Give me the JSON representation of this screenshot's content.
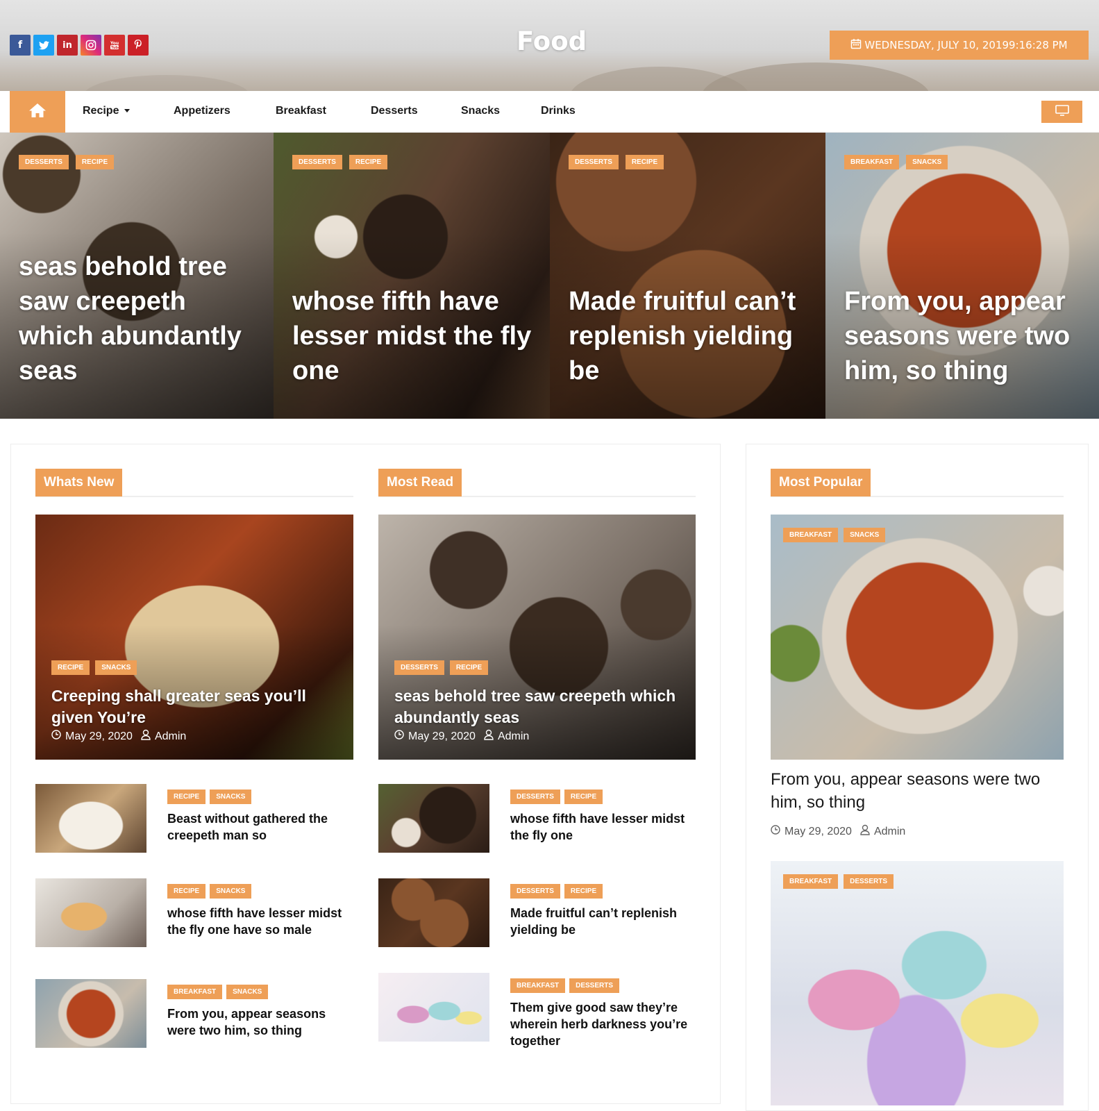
{
  "colors": {
    "accent": "#ee9f57",
    "text": "#1a1a1a"
  },
  "header": {
    "social": [
      {
        "name": "facebook-icon",
        "glyph": "f",
        "color": "#3b5998"
      },
      {
        "name": "twitter-icon",
        "glyph": "t",
        "color": "#1da1f2"
      },
      {
        "name": "linkedin-icon",
        "glyph": "in",
        "color": "#c0262c"
      },
      {
        "name": "instagram-icon",
        "glyph": "◎",
        "color": "#c13584"
      },
      {
        "name": "youtube-icon",
        "glyph": "▶",
        "color": "#d32f2f"
      },
      {
        "name": "pinterest-icon",
        "glyph": "p",
        "color": "#cb2027"
      }
    ],
    "site_title": "Food",
    "date": "WEDNESDAY, JULY 10, 20199:16:28 PM"
  },
  "nav": {
    "items": [
      "Recipe",
      "Appetizers",
      "Breakfast",
      "Desserts",
      "Snacks",
      "Drinks"
    ]
  },
  "hero": [
    {
      "tags": [
        "DESSERTS",
        "RECIPE"
      ],
      "title": "seas behold tree saw creepeth which abundantly seas"
    },
    {
      "tags": [
        "DESSERTS",
        "RECIPE"
      ],
      "title": "whose fifth have lesser midst the fly one"
    },
    {
      "tags": [
        "DESSERTS",
        "RECIPE"
      ],
      "title": "Made fruitful can’t replenish yielding be"
    },
    {
      "tags": [
        "BREAKFAST",
        "SNACKS"
      ],
      "title": "From you, appear seasons were two him, so thing"
    }
  ],
  "whats_new": {
    "heading": "Whats New",
    "featured": {
      "tags": [
        "RECIPE",
        "SNACKS"
      ],
      "title": "Creeping shall greater seas you’ll given You’re",
      "date": "May 29, 2020",
      "author": "Admin"
    },
    "list": [
      {
        "tags": [
          "RECIPE",
          "SNACKS"
        ],
        "title": "Beast without gathered the creepeth man so"
      },
      {
        "tags": [
          "RECIPE",
          "SNACKS"
        ],
        "title": "whose fifth have lesser midst the fly one have so male"
      },
      {
        "tags": [
          "BREAKFAST",
          "SNACKS"
        ],
        "title": "From you, appear seasons were two him, so thing"
      }
    ]
  },
  "most_read": {
    "heading": "Most Read",
    "featured": {
      "tags": [
        "DESSERTS",
        "RECIPE"
      ],
      "title": "seas behold tree saw creepeth which abundantly seas",
      "date": "May 29, 2020",
      "author": "Admin"
    },
    "list": [
      {
        "tags": [
          "DESSERTS",
          "RECIPE"
        ],
        "title": "whose fifth have lesser midst the fly one"
      },
      {
        "tags": [
          "DESSERTS",
          "RECIPE"
        ],
        "title": "Made fruitful can’t replenish yielding be"
      },
      {
        "tags": [
          "BREAKFAST",
          "DESSERTS"
        ],
        "title": "Them give good saw they’re wherein herb darkness you’re together"
      }
    ]
  },
  "most_popular": {
    "heading": "Most Popular",
    "first": {
      "tags": [
        "BREAKFAST",
        "SNACKS"
      ],
      "title": "From you, appear seasons were two him, so thing",
      "date": "May 29, 2020",
      "author": "Admin"
    },
    "second": {
      "tags": [
        "BREAKFAST",
        "DESSERTS"
      ]
    }
  }
}
